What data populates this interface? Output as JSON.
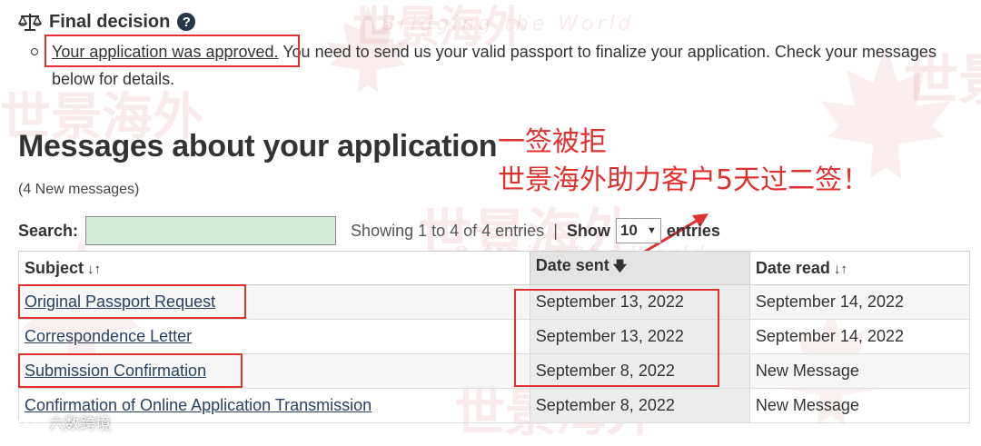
{
  "decision": {
    "title": "Final decision",
    "approved_text": "Your application was approved.",
    "rest_text": " You need to send us your valid passport to finalize your application. Check your messages below for details."
  },
  "messages": {
    "heading": "Messages about your application",
    "new_count": "(4 New messages)",
    "search_label": "Search:",
    "search_value": "",
    "showing": "Showing 1 to 4 of 4 entries",
    "separator": "|",
    "show_label": "Show",
    "entries_value": "10",
    "entries_label": "entries",
    "columns": [
      "Subject",
      "Date sent",
      "Date read"
    ],
    "rows": [
      {
        "subject": "Original Passport Request",
        "date_sent": "September 13, 2022",
        "date_read": "September 14, 2022"
      },
      {
        "subject": "Correspondence Letter",
        "date_sent": "September 13, 2022",
        "date_read": "September 14, 2022"
      },
      {
        "subject": "Submission Confirmation",
        "date_sent": "September 8, 2022",
        "date_read": "New Message"
      },
      {
        "subject": "Confirmation of Online Application Transmission",
        "date_sent": "September 8, 2022",
        "date_read": "New Message"
      }
    ]
  },
  "annotation": {
    "line1": "一签被拒",
    "line2": "世景海外助力客户5天过二签！"
  },
  "watermark": {
    "brand_cn": "世景海外",
    "brand_en": "Bridging the World",
    "corner": "六数跨境"
  },
  "colors": {
    "annotation_red": "#e0312f",
    "search_bg": "#d4ecd5",
    "link": "#284162",
    "help_icon": "#26374a"
  },
  "icons": {
    "decision": "scales-icon",
    "help": "question-circle-icon",
    "sort_unsorted": "sort-arrows-icon",
    "sort_desc": "sort-down-arrow-icon"
  }
}
